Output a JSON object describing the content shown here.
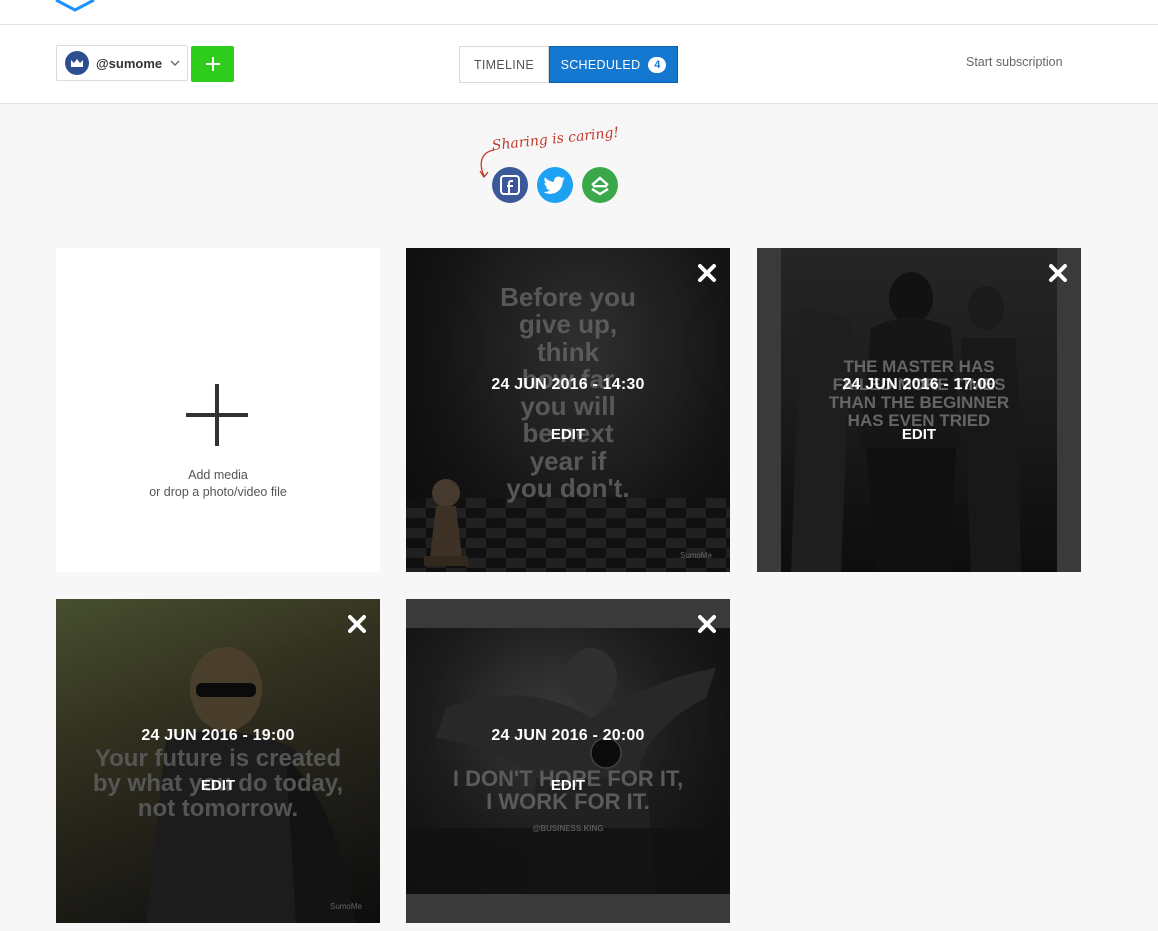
{
  "account": {
    "handle": "@sumome"
  },
  "tabs": {
    "timeline_label": "TIMELINE",
    "scheduled_label": "SCHEDULED",
    "scheduled_count": "4"
  },
  "toolbar": {
    "start_subscription": "Start subscription"
  },
  "share": {
    "tagline": "Sharing is caring!"
  },
  "add_media": {
    "title": "Add media",
    "subtitle": "or drop a photo/video file"
  },
  "posts": [
    {
      "date": "24 JUN 2016 - 14:30",
      "edit": "EDIT",
      "quote": [
        "Before you",
        "give up,",
        "think",
        "how far",
        "you will",
        "be next",
        "year if",
        "you don't."
      ],
      "watermark": "SumoMe"
    },
    {
      "date": "24 JUN 2016 - 17:00",
      "edit": "EDIT",
      "quote": [
        "THE MASTER HAS",
        "FAILED MORE TIMES",
        "THAN THE BEGINNER",
        "HAS EVEN TRIED"
      ],
      "watermark": ""
    },
    {
      "date": "24 JUN 2016 - 19:00",
      "edit": "EDIT",
      "quote": [
        "Your future is created",
        "by what you do today,",
        "not tomorrow."
      ],
      "watermark": "SumoMe"
    },
    {
      "date": "24 JUN 2016 - 20:00",
      "edit": "EDIT",
      "quote": [
        "I DON'T HOPE FOR IT,",
        "I WORK FOR IT."
      ],
      "watermark": "@BUSINESS.KING"
    }
  ],
  "colors": {
    "accent": "#1478d1",
    "add_button": "#2ecc1b",
    "facebook": "#3b5998",
    "twitter": "#1da1f2",
    "sumome": "#3aa84a"
  },
  "icons": {
    "add": "plus-icon",
    "close": "close-icon",
    "dropdown": "chevron-down-icon",
    "facebook": "facebook-icon",
    "twitter": "twitter-icon",
    "sumome": "sumome-share-icon"
  }
}
